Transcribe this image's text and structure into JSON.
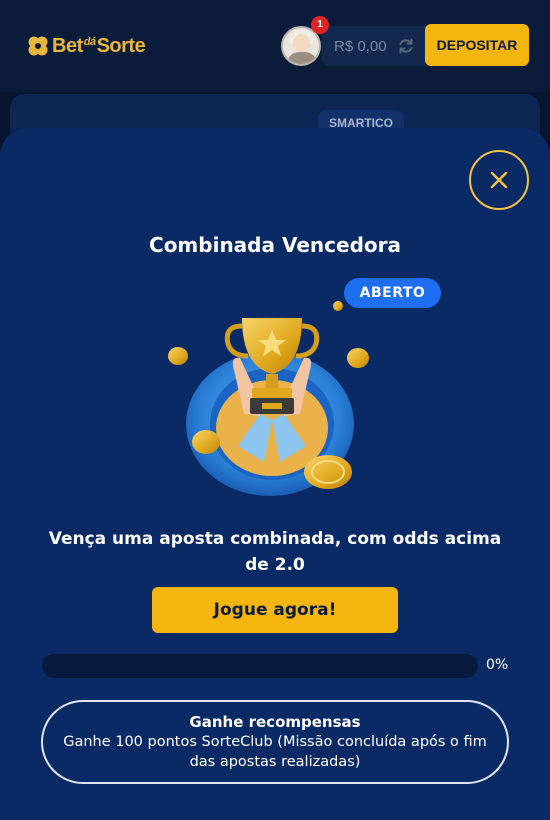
{
  "header": {
    "logo": {
      "main": "Bet",
      "small": "dá",
      "end": "Sorte"
    },
    "notification_count": "1",
    "balance": "R$ 0,00",
    "deposit_label": "DEPOSITAR",
    "provider_badge": "SMARTICO"
  },
  "mission": {
    "title": "Combinada Vencedora",
    "status": "ABERTO",
    "description": "Vença uma aposta combinada, com odds acima de 2.0",
    "cta_label": "Jogue agora!",
    "progress": {
      "value": 0,
      "label": "0%"
    },
    "rewards": {
      "title": "Ganhe recompensas",
      "text": "Ganhe 100 pontos SorteClub (Missão concluída após o fim das apostas realizadas)"
    }
  },
  "colors": {
    "accent": "#f5b50f",
    "modal_bg": "#0a2a66",
    "status_badge": "#1d6ef0",
    "notification": "#e02424"
  },
  "icons": {
    "close": "close-icon",
    "refresh": "refresh-icon",
    "logo": "clover-icon",
    "illustration": "trophy-icon"
  }
}
